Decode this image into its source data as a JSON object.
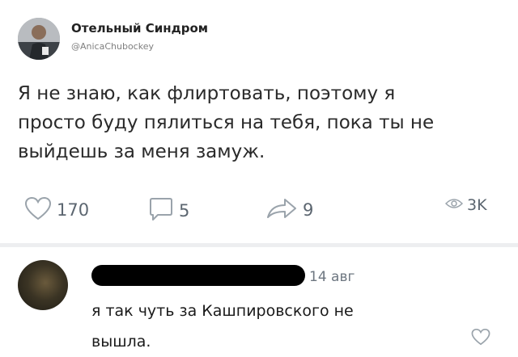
{
  "post": {
    "author_name": "Отельный Синдром",
    "author_handle": "@AnicaChubockey",
    "text": "Я не знаю, как флиртовать, поэтому я\nпросто буду пялиться на тебя, пока ты не\nвыйдешь за меня замуж.",
    "actions": {
      "likes": "170",
      "comments": "5",
      "shares": "9",
      "views": "3K"
    }
  },
  "comment": {
    "date": "14 авг",
    "text": "я так чуть за Кашпировского не\nвышла."
  },
  "icons": {
    "like": "heart-icon",
    "comment": "comment-bubble-icon",
    "share": "share-arrow-icon",
    "views": "eye-icon",
    "comment_like": "heart-icon"
  }
}
